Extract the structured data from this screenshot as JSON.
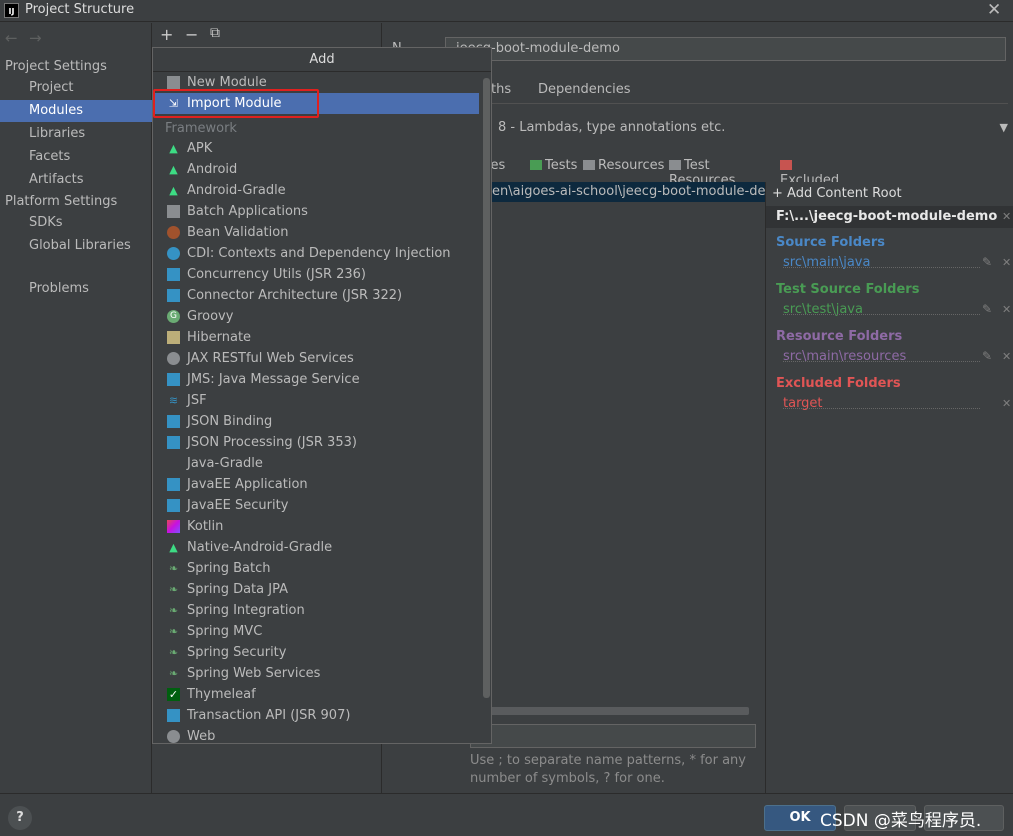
{
  "window": {
    "title": "Project Structure",
    "logo_text": "IJ",
    "close_glyph": "✕"
  },
  "nav": {
    "back": "←",
    "forward": "→"
  },
  "left": {
    "project_settings": "Project Settings",
    "project_items": [
      "Project",
      "Modules",
      "Libraries",
      "Facets",
      "Artifacts"
    ],
    "platform_settings": "Platform Settings",
    "platform_items": [
      "SDKs",
      "Global Libraries"
    ],
    "problems": "Problems",
    "selected": "Modules"
  },
  "toolbar": {
    "add": "+",
    "remove": "−",
    "copy": "⧉"
  },
  "module": {
    "name_label": "N",
    "name_value": "jeecg-boot-module-demo",
    "tabs": [
      "ths",
      "Dependencies"
    ],
    "language_level": "8 - Lambdas, type annotations etc.",
    "mark_as": [
      "urces",
      "Tests",
      "Resources",
      "Test Resources",
      "Excluded"
    ],
    "tree_row": "en\\aigoes-ai-school\\jeecg-boot-module-demo",
    "hint": "Use ; to separate name patterns, * for any number of symbols, ? for one."
  },
  "content_root": {
    "add_label": "Add Content Root",
    "path": "F:\\...\\jeecg-boot-module-demo",
    "source_title": "Source Folders",
    "source_value": "src\\main\\java",
    "test_title": "Test Source Folders",
    "test_value": "src\\test\\java",
    "resource_title": "Resource Folders",
    "resource_value": "src\\main\\resources",
    "excluded_title": "Excluded Folders",
    "excluded_value": "target"
  },
  "popup": {
    "title": "Add",
    "new_module": "New Module",
    "import_module": "Import Module",
    "group_label": "Framework",
    "frameworks": [
      "APK",
      "Android",
      "Android-Gradle",
      "Batch Applications",
      "Bean Validation",
      "CDI: Contexts and Dependency Injection",
      "Concurrency Utils (JSR 236)",
      "Connector Architecture (JSR 322)",
      "Groovy",
      "Hibernate",
      "JAX RESTful Web Services",
      "JMS: Java Message Service",
      "JSF",
      "JSON Binding",
      "JSON Processing (JSR 353)",
      "Java-Gradle",
      "JavaEE Application",
      "JavaEE Security",
      "Kotlin",
      "Native-Android-Gradle",
      "Spring Batch",
      "Spring Data JPA",
      "Spring Integration",
      "Spring MVC",
      "Spring Security",
      "Spring Web Services",
      "Thymeleaf",
      "Transaction API (JSR 907)",
      "Web"
    ],
    "framework_icons": [
      "android-icon",
      "android-icon",
      "android-icon",
      "folder-icon",
      "bean-icon",
      "cdi-icon",
      "module-icon",
      "module-icon",
      "groovy-icon",
      "hibernate-icon",
      "globe-icon",
      "module-icon",
      "jsf-icon",
      "module-icon",
      "module-icon",
      "none",
      "javaee-icon",
      "module-icon",
      "kotlin-icon",
      "android-icon",
      "spring-icon",
      "spring-icon",
      "spring-icon",
      "spring-icon",
      "spring-icon",
      "spring-icon",
      "thymeleaf-icon",
      "module-icon",
      "web-icon"
    ]
  },
  "footer": {
    "help": "?",
    "ok": "OK",
    "watermark": "CSDN @菜鸟程序员."
  },
  "colors": {
    "selection": "#4b6eaf",
    "source": "#4a88c7",
    "test": "#499c54",
    "resource": "#8e6aa5",
    "excluded": "#e05555",
    "highlight_box": "#e0201e"
  }
}
